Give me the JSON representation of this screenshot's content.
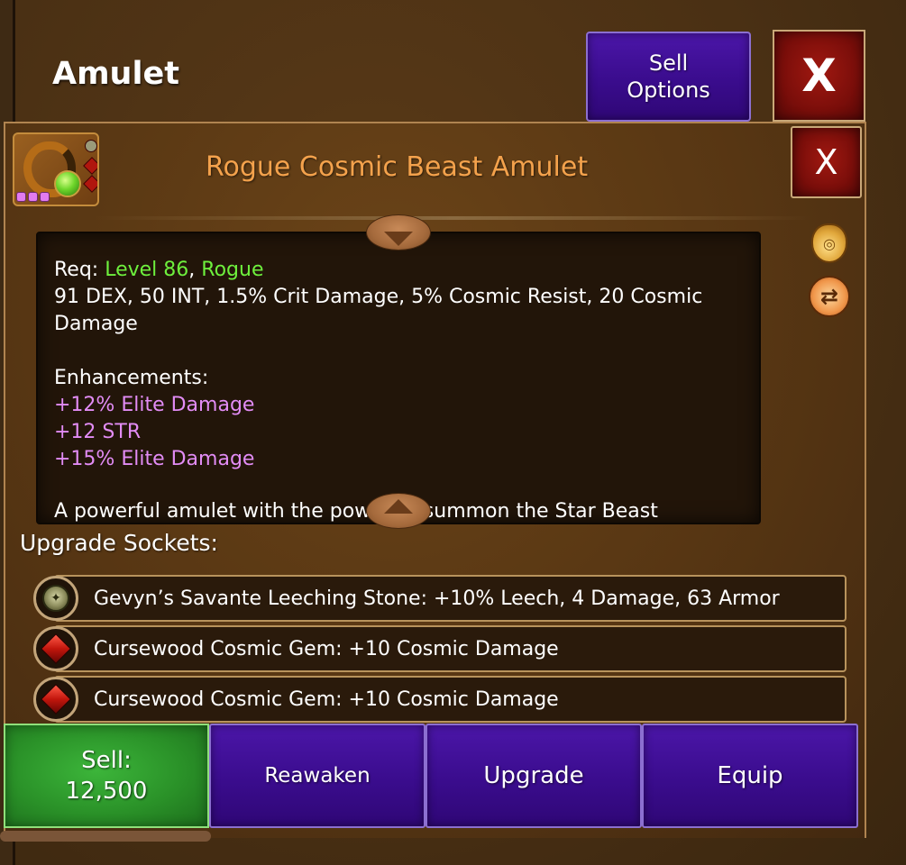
{
  "window": {
    "title": "Amulet",
    "sell_options_line1": "Sell",
    "sell_options_line2": "Options",
    "close_label": "X"
  },
  "item": {
    "name": "Rogue Cosmic Beast Amulet",
    "close_label": "X",
    "rarity_pips": 3,
    "req_label": "Req:",
    "req_level": "Level 86",
    "req_sep": ",",
    "req_class": "Rogue",
    "stats": "91 DEX, 50 INT, 1.5% Crit Damage, 5% Cosmic Resist, 20 Cosmic Damage",
    "enhancements_label": "Enhancements:",
    "enhancements": [
      "+12% Elite Damage",
      "+12 STR",
      "+15% Elite Damage"
    ],
    "description_cut": "A powerful amulet with the power to summon the Star Beast"
  },
  "sockets": {
    "title": "Upgrade Sockets:",
    "items": [
      {
        "label": "Gevyn’s Savante Leeching Stone: +10% Leech, 4 Damage, 63 Armor",
        "icon": "leeching-stone-icon"
      },
      {
        "label": "Cursewood Cosmic Gem: +10 Cosmic Damage",
        "icon": "red-gem-icon"
      },
      {
        "label": "Cursewood Cosmic Gem: +10 Cosmic Damage",
        "icon": "red-gem-icon"
      }
    ]
  },
  "actions": {
    "sell_label": "Sell:",
    "sell_price": "12,500",
    "reawaken": "Reawaken",
    "upgrade": "Upgrade",
    "equip": "Equip"
  },
  "colors": {
    "item_name": "#f4a24c",
    "requirement": "#6ef03d",
    "enhancement": "#e28cf5",
    "button_purple": "#3a0c8d",
    "button_green": "#2a9128",
    "button_red": "#7a0e0a"
  }
}
